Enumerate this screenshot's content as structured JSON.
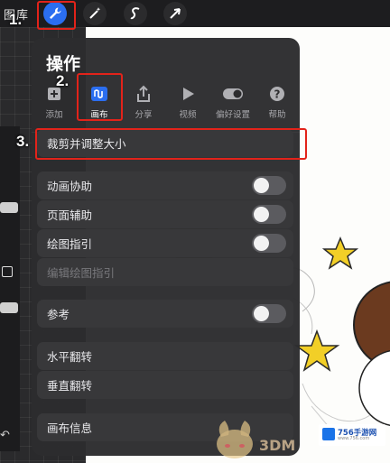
{
  "topbar": {
    "gallery_label": "图库",
    "tools": [
      {
        "icon": "wrench-icon",
        "active": true
      },
      {
        "icon": "magic-wand-icon",
        "active": false
      },
      {
        "icon": "selection-s-icon",
        "active": false
      },
      {
        "icon": "transform-arrow-icon",
        "active": false
      }
    ]
  },
  "actions_panel": {
    "title": "操作",
    "tabs": [
      {
        "label": "添加",
        "icon": "add-plus-icon"
      },
      {
        "label": "画布",
        "icon": "canvas-icon",
        "selected": true
      },
      {
        "label": "分享",
        "icon": "share-icon"
      },
      {
        "label": "视频",
        "icon": "video-play-icon"
      },
      {
        "label": "偏好设置",
        "icon": "preferences-toggle-icon"
      },
      {
        "label": "帮助",
        "icon": "help-question-icon"
      }
    ],
    "rows": [
      {
        "label": "裁剪并调整大小"
      },
      {
        "label": "动画协助",
        "toggle": false
      },
      {
        "label": "页面辅助",
        "toggle": false
      },
      {
        "label": "绘图指引",
        "toggle": false
      },
      {
        "label": "编辑绘图指引",
        "disabled": true
      },
      {
        "label": "参考",
        "toggle": false
      },
      {
        "label": "水平翻转"
      },
      {
        "label": "垂直翻转"
      },
      {
        "label": "画布信息"
      }
    ]
  },
  "annotations": {
    "step1": "1.",
    "step2": "2.",
    "step3": "3.",
    "color": "#e2231a"
  },
  "watermarks": {
    "site_3dm": "3DM",
    "logo_text": "756手游网",
    "logo_url": "www.756.com"
  },
  "colors": {
    "accent": "#2b6ef0",
    "panel": "#2c2c2e",
    "row": "#38383a",
    "toggle_off": "#5b5b5f"
  }
}
